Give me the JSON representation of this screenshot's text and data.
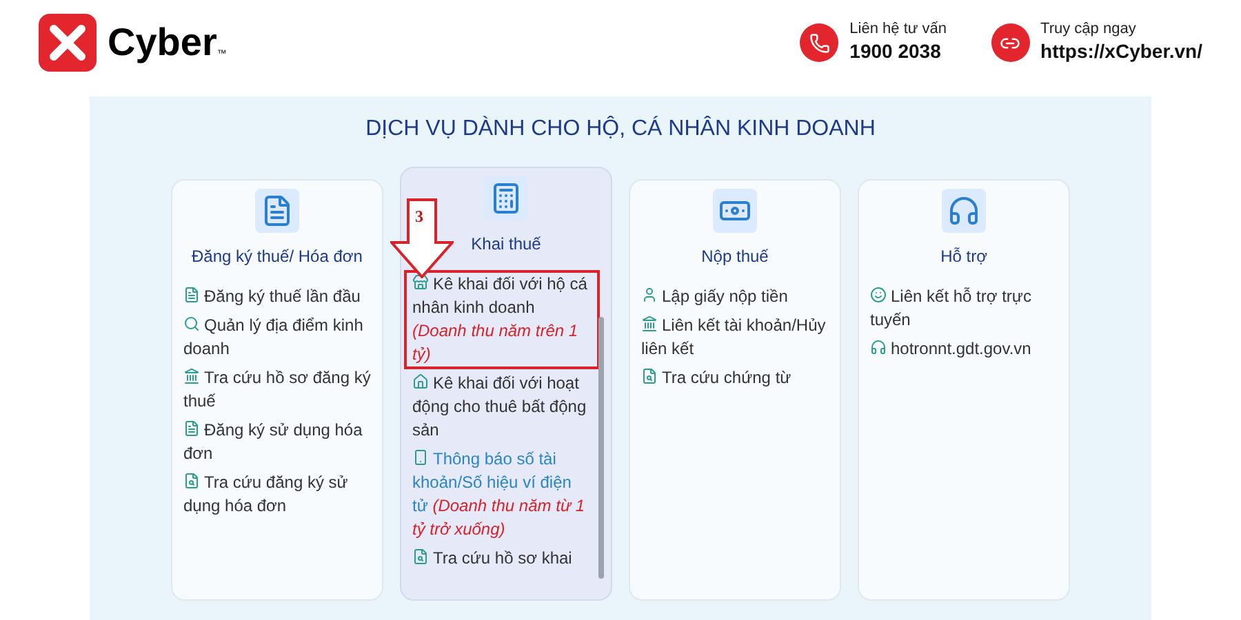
{
  "header": {
    "logo_text": "Cyber",
    "logo_mark": "™",
    "contacts": [
      {
        "label": "Liên hệ tư vấn",
        "value": "1900 2038"
      },
      {
        "label": "Truy cập ngay",
        "value": "https://xCyber.vn/"
      }
    ]
  },
  "title": "DỊCH VỤ DÀNH CHO HỘ, CÁ NHÂN KINH DOANH",
  "annotation": {
    "label": "3"
  },
  "cards": [
    {
      "title": "Đăng ký thuế/ Hóa đơn",
      "selected": false,
      "items": [
        {
          "text": "Đăng ký thuế lần đầu",
          "highlighted": false,
          "boxed": false
        },
        {
          "text": "Quản lý địa điểm kinh doanh",
          "highlighted": false,
          "boxed": false
        },
        {
          "text": "Tra cứu hồ sơ đăng ký thuế",
          "highlighted": false,
          "boxed": false
        },
        {
          "text": "Đăng ký sử dụng hóa đơn",
          "highlighted": false,
          "boxed": false
        },
        {
          "text": "Tra cứu đăng ký sử dụng hóa đơn",
          "highlighted": false,
          "boxed": false
        }
      ]
    },
    {
      "title": "Khai thuế",
      "selected": true,
      "items": [
        {
          "text": "Kê khai đối với hộ cá nhân kinh doanh",
          "note": "(Doanh thu năm trên 1 tỷ)",
          "highlighted": false,
          "boxed": true
        },
        {
          "text": "Kê khai đối với hoạt động cho thuê bất động sản",
          "highlighted": false,
          "boxed": false
        },
        {
          "text": "Thông báo số tài khoản/Số hiệu ví điện tử",
          "note": "(Doanh thu năm từ 1 tỷ trở xuống)",
          "highlighted": true,
          "boxed": false
        },
        {
          "text": "Tra cứu hồ sơ khai",
          "highlighted": false,
          "boxed": false
        }
      ]
    },
    {
      "title": "Nộp thuế",
      "selected": false,
      "items": [
        {
          "text": "Lập giấy nộp tiền",
          "highlighted": false,
          "boxed": false
        },
        {
          "text": "Liên kết tài khoản/Hủy liên kết",
          "highlighted": false,
          "boxed": false
        },
        {
          "text": "Tra cứu chứng từ",
          "highlighted": false,
          "boxed": false
        }
      ]
    },
    {
      "title": "Hỗ trợ",
      "selected": false,
      "items": [
        {
          "text": "Liên kết hỗ trợ trực tuyến",
          "highlighted": false,
          "boxed": false
        },
        {
          "text": "hotronnt.gdt.gov.vn",
          "highlighted": false,
          "boxed": false
        }
      ]
    }
  ]
}
